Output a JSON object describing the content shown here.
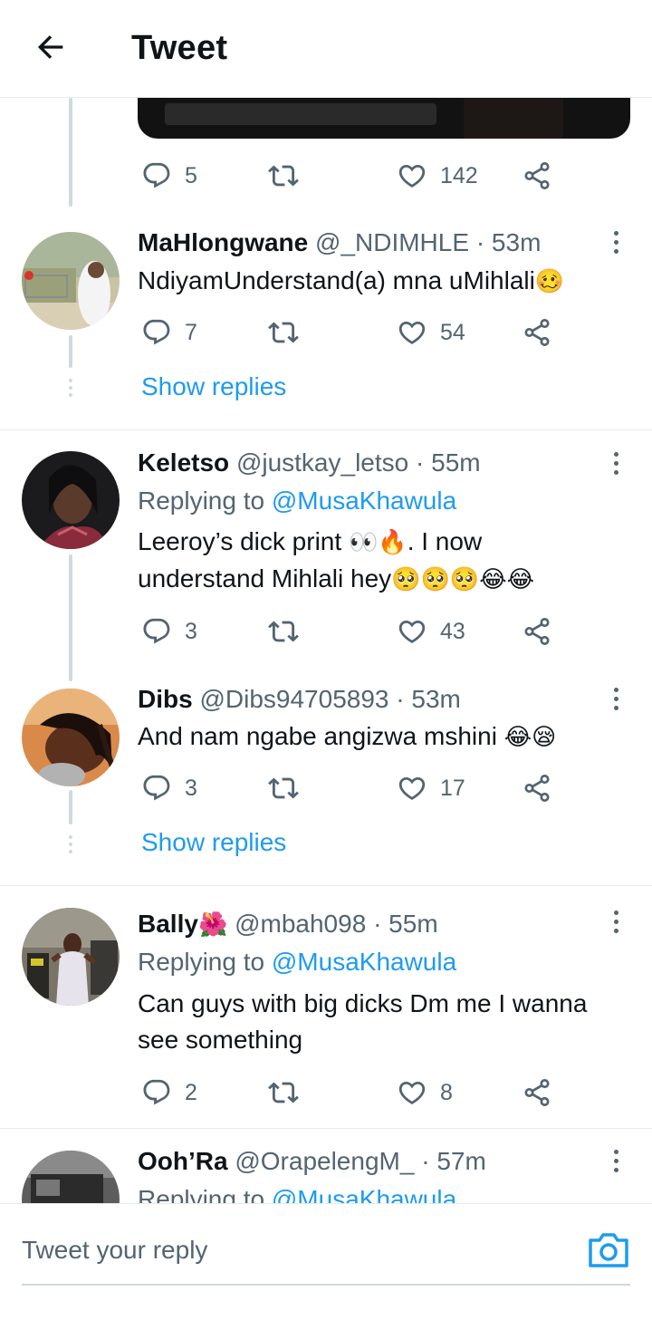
{
  "header": {
    "title": "Tweet"
  },
  "original_tweet": {
    "reply_count": "5",
    "like_count": "142"
  },
  "replies": [
    {
      "name": "MaHlongwane",
      "handle": "@_NDIMHLE",
      "time": "53m",
      "replying_to": "",
      "text": "NdiyamUnderstand(a) mna uMihlali",
      "emoji": "🥴",
      "reply_count": "7",
      "like_count": "54",
      "show_replies": "Show replies"
    },
    {
      "name": "Keletso",
      "handle": "@justkay_letso",
      "time": "55m",
      "replying_label": "Replying to",
      "replying_to": "@MusaKhawula",
      "text_line1": "Leeroy’s dick print",
      "emoji_line1": "👀🔥",
      "text_line1_end": ". I now",
      "text_line2": "understand Mihlali hey",
      "emoji_line2": "🥺🥺🥺😂😂",
      "reply_count": "3",
      "like_count": "43"
    },
    {
      "name": "Dibs",
      "handle": "@Dibs94705893",
      "time": "53m",
      "replying_to": "",
      "text": "And nam ngabe angizwa mshini",
      "emoji": "😂😪",
      "reply_count": "3",
      "like_count": "17",
      "show_replies": "Show replies"
    },
    {
      "name": "Bally",
      "name_emoji": "🌺",
      "handle": "@mbah098",
      "time": "55m",
      "replying_label": "Replying to",
      "replying_to": "@MusaKhawula",
      "text_line1": "Can guys with big dicks Dm me I wanna",
      "text_line2": "see something",
      "reply_count": "2",
      "like_count": "8"
    },
    {
      "name": "Ooh’Ra",
      "handle": "@OrapelengM_",
      "time": "57m",
      "replying_label": "Replying to",
      "replying_to": "@MusaKhawula"
    }
  ],
  "composer": {
    "placeholder": "Tweet your reply"
  },
  "separator": "·",
  "colors": {
    "accent": "#1d9bf0",
    "muted": "#536471",
    "text": "#0f1419",
    "line": "#cfd9de"
  },
  "icons": [
    "back-arrow-icon",
    "reply-bubble-icon",
    "retweet-icon",
    "like-heart-icon",
    "share-icon",
    "more-vertical-icon",
    "camera-icon"
  ]
}
